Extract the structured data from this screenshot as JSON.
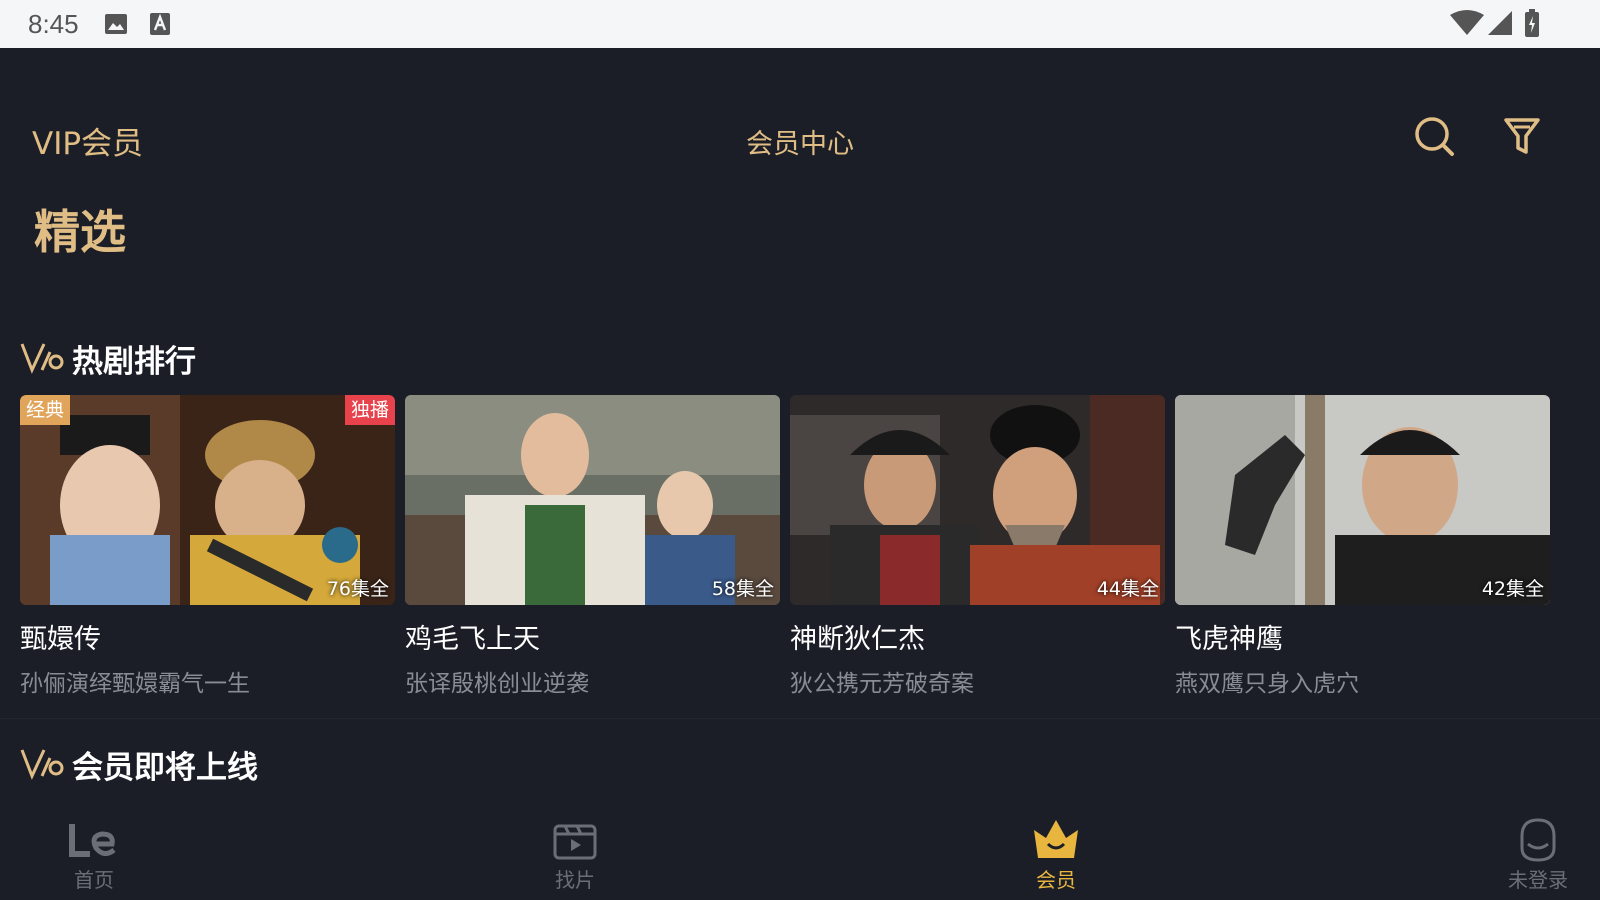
{
  "status_bar": {
    "time": "8:45",
    "icons": [
      "image-icon",
      "text-a-icon",
      "wifi-icon",
      "signal-icon",
      "battery-charging-icon"
    ]
  },
  "header": {
    "vip_title": "VIP会员",
    "center_title": "会员中心",
    "buttons": [
      "search-icon",
      "filter-icon"
    ],
    "accent_color": "#e0bd85"
  },
  "page_title": "精选",
  "sections": [
    {
      "title": "热剧排行",
      "items": [
        {
          "title": "甄嬛传",
          "subtitle": "孙俪演绎甄嬛霸气一生",
          "episodes": "76集全",
          "badge_left": "经典",
          "badge_right": "独播"
        },
        {
          "title": "鸡毛飞上天",
          "subtitle": "张译殷桃创业逆袭",
          "episodes": "58集全"
        },
        {
          "title": "神断狄仁杰",
          "subtitle": "狄公携元芳破奇案",
          "episodes": "44集全"
        },
        {
          "title": "飞虎神鹰",
          "subtitle": "燕双鹰只身入虎穴",
          "episodes": "42集全"
        }
      ]
    },
    {
      "title": "会员即将上线",
      "items": []
    }
  ],
  "bottom_nav": {
    "items": [
      {
        "label": "首页",
        "icon": "le-logo-icon",
        "active": false
      },
      {
        "label": "找片",
        "icon": "film-play-icon",
        "active": false
      },
      {
        "label": "会员",
        "icon": "crown-icon",
        "active": true
      },
      {
        "label": "未登录",
        "icon": "user-icon",
        "active": false
      }
    ],
    "active_color": "#e8b63e"
  }
}
